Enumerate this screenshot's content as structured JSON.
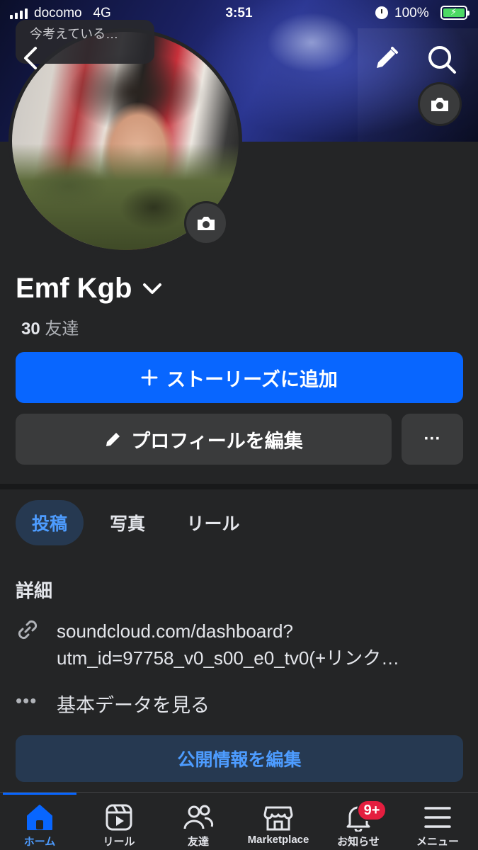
{
  "status_bar": {
    "carrier": "docomo",
    "network": "4G",
    "time": "3:51",
    "battery": "100%"
  },
  "status_popup": {
    "text": "今考えている…"
  },
  "profile": {
    "name": "Emf Kgb",
    "friends_count": "30",
    "friends_label": "友達"
  },
  "actions": {
    "add_story": "ストーリーズに追加",
    "edit_profile": "プロフィールを編集",
    "more": "···"
  },
  "tabs": [
    {
      "label": "投稿",
      "active": true
    },
    {
      "label": "写真",
      "active": false
    },
    {
      "label": "リール",
      "active": false
    }
  ],
  "details": {
    "title": "詳細",
    "link_line1": "soundcloud.com/dashboard?",
    "link_line2": "utm_id=97758_v0_s00_e0_tv0(+リンク…",
    "basic_info": "基本データを見る",
    "edit_public": "公開情報を編集"
  },
  "bottom_nav": {
    "home": "ホーム",
    "reels": "リール",
    "friends": "友達",
    "marketplace": "Marketplace",
    "notifications": "お知らせ",
    "notifications_badge": "9+",
    "menu": "メニュー"
  },
  "colors": {
    "background": "#242526",
    "accent": "#0866ff",
    "accent_text": "#4d9cff",
    "button_gray": "#3a3b3c",
    "badge": "#e41e3f"
  },
  "icons": [
    "back-icon",
    "edit-icon",
    "search-icon",
    "camera-icon",
    "chevron-down-icon",
    "plus-icon",
    "pencil-icon",
    "link-icon",
    "more-dots-icon",
    "home-icon",
    "reels-icon",
    "friends-icon",
    "marketplace-icon",
    "bell-icon",
    "menu-icon"
  ]
}
